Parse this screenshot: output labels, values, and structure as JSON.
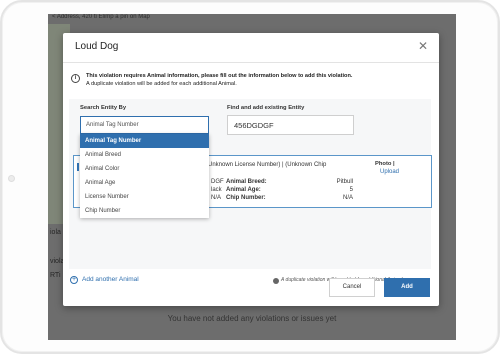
{
  "background": {
    "breadcrumb": "< Address, 420 ti Elimp a pin on Map",
    "side_labels": [
      "iola",
      "viola",
      "RTi"
    ],
    "bottom_text": "You have not added any violations or issues yet"
  },
  "modal": {
    "title": "Loud Dog",
    "close_icon": "close-icon",
    "info": {
      "line1": "This violation requires Animal information, please fill out the information below to add this violation.",
      "line2": "A duplicate violation will be added for each additional Animal."
    },
    "search_entity_label": "Search Entity By",
    "search_entity_value": "Animal Tag Number",
    "find_existing_label": "Find and add existing Entity",
    "find_existing_value": "456DGDGF",
    "dropdown_options": [
      "Animal Tag Number",
      "Animal Breed",
      "Animal Color",
      "Animal Age",
      "License Number",
      "Chip Number"
    ],
    "entity_card": {
      "title": "Unknown License Number) | (Unknown Chip",
      "photo_label": "Photo |",
      "upload_label": "Upload",
      "partial_values": [
        "DGF",
        "lack",
        "N/A"
      ],
      "fields": [
        {
          "label": "Animal Breed:",
          "value": "Pitbull"
        },
        {
          "label": "Animal Age:",
          "value": "5"
        },
        {
          "label": "Chip Number:",
          "value": "N/A"
        }
      ]
    },
    "add_another_label": "Add another Animal",
    "duplicate_note": "A duplicate violation will be added for additional Animal.",
    "cancel_label": "Cancel",
    "add_label": "Add"
  },
  "colors": {
    "accent": "#2f6fae",
    "overlay": "#6d6d6d"
  }
}
